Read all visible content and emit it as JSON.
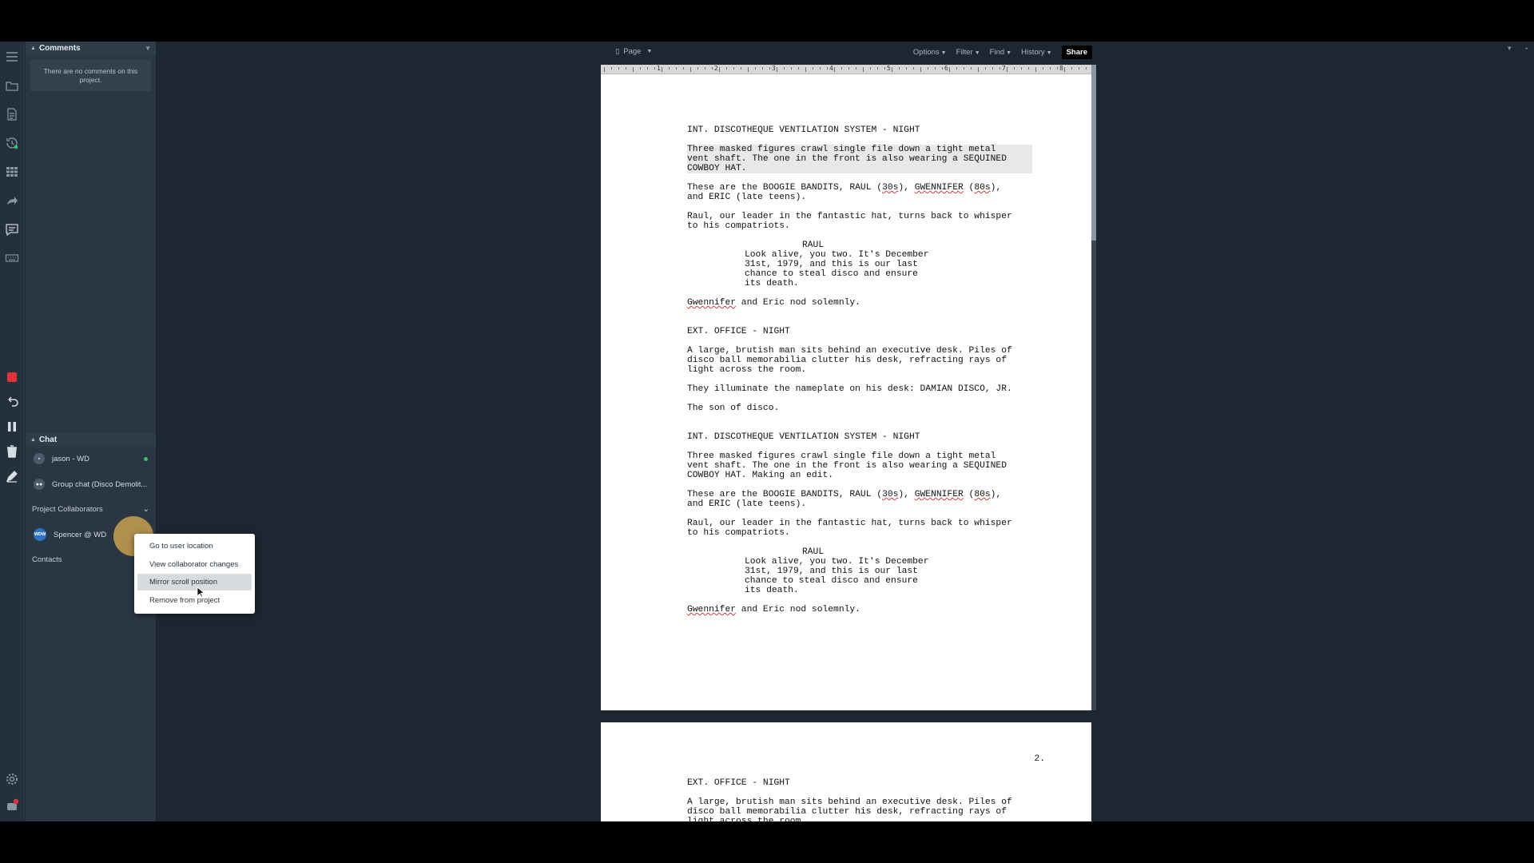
{
  "toolbar": {
    "page_label": "Page",
    "options_label": "Options",
    "filter_label": "Filter",
    "find_label": "Find",
    "history_label": "History",
    "share_label": "Share"
  },
  "comments": {
    "title": "Comments",
    "empty_text": "There are no comments on this project."
  },
  "chat": {
    "title": "Chat",
    "items": [
      {
        "label": "jason - WD"
      },
      {
        "label": "Group chat (Disco Demolit..."
      }
    ],
    "collaborators_label": "Project Collaborators",
    "collaborator": {
      "name": "Spencer @ WD",
      "avatar": "WDW"
    },
    "contacts_label": "Contacts"
  },
  "context_menu": {
    "items": [
      "Go to user location",
      "View collaborator changes",
      "Mirror scroll position",
      "Remove from project"
    ],
    "active_index": 2
  },
  "ruler": {
    "numbers": [
      "1",
      "2",
      "3",
      "4",
      "5",
      "6",
      "7",
      "8"
    ]
  },
  "script": {
    "p1": {
      "scene1": "INT. DISCOTHEQUE VENTILATION SYSTEM - NIGHT",
      "action1": "Three masked figures crawl single file down a tight metal\nvent shaft. The one in the front is also wearing a SEQUINED\nCOWBOY HAT.",
      "action2_a": "These are the BOOGIE BANDITS, RAUL (",
      "action2_b": "30s",
      "action2_c": "), ",
      "action2_d": "GWENNIFER",
      "action2_e": " (",
      "action2_f": "80s",
      "action2_g": "),\nand ERIC (late teens).",
      "action3": "Raul, our leader in the fantastic hat, turns back to whisper\nto his compatriots.",
      "char1": "RAUL",
      "dial1": "Look alive, you two. It's December\n31st, 1979, and this is our last\nchance to steal disco and ensure\nits death.",
      "action4_a": "Gwennifer",
      "action4_b": " and Eric nod solemnly.",
      "scene2": "EXT. OFFICE - NIGHT",
      "action5": "A large, brutish man sits behind an executive desk. Piles of\ndisco ball memorabilia clutter his desk, refracting rays of\nlight across the room.",
      "action6": "They illuminate the nameplate on his desk: DAMIAN DISCO, JR.",
      "action7": "The son of disco.",
      "scene3": "INT. DISCOTHEQUE VENTILATION SYSTEM - NIGHT",
      "action8": "Three masked figures crawl single file down a tight metal\nvent shaft. The one in the front is also wearing a SEQUINED\nCOWBOY HAT. Making an edit.",
      "action9_a": "These are the BOOGIE BANDITS, RAUL (",
      "action9_b": "30s",
      "action9_c": "), ",
      "action9_d": "GWENNIFER",
      "action9_e": " (",
      "action9_f": "80s",
      "action9_g": "),\nand ERIC (late teens).",
      "action10": "Raul, our leader in the fantastic hat, turns back to whisper\nto his compatriots.",
      "char2": "RAUL",
      "dial2": "Look alive, you two. It's December\n31st, 1979, and this is our last\nchance to steal disco and ensure\nits death.",
      "action11_a": "Gwennifer",
      "action11_b": " and Eric nod solemnly."
    },
    "p2": {
      "page_number": "2.",
      "scene1": "EXT. OFFICE - NIGHT",
      "action1": "A large, brutish man sits behind an executive desk. Piles of\ndisco ball memorabilia clutter his desk, refracting rays of\nlight across the room."
    }
  },
  "rail_icons": [
    "menu-icon",
    "folder-icon",
    "document-icon",
    "history-icon",
    "grid-icon",
    "share-arrow-icon",
    "comment-icon",
    "keyboard-icon",
    "record-icon",
    "undo-icon",
    "pause-icon",
    "trash-icon",
    "pen-icon",
    "settings-icon",
    "notifications-icon"
  ],
  "notification_count": "1",
  "colors": {
    "accent_record": "#e0333b",
    "online": "#3ac26a",
    "cursor_highlight": "#b8944e"
  }
}
